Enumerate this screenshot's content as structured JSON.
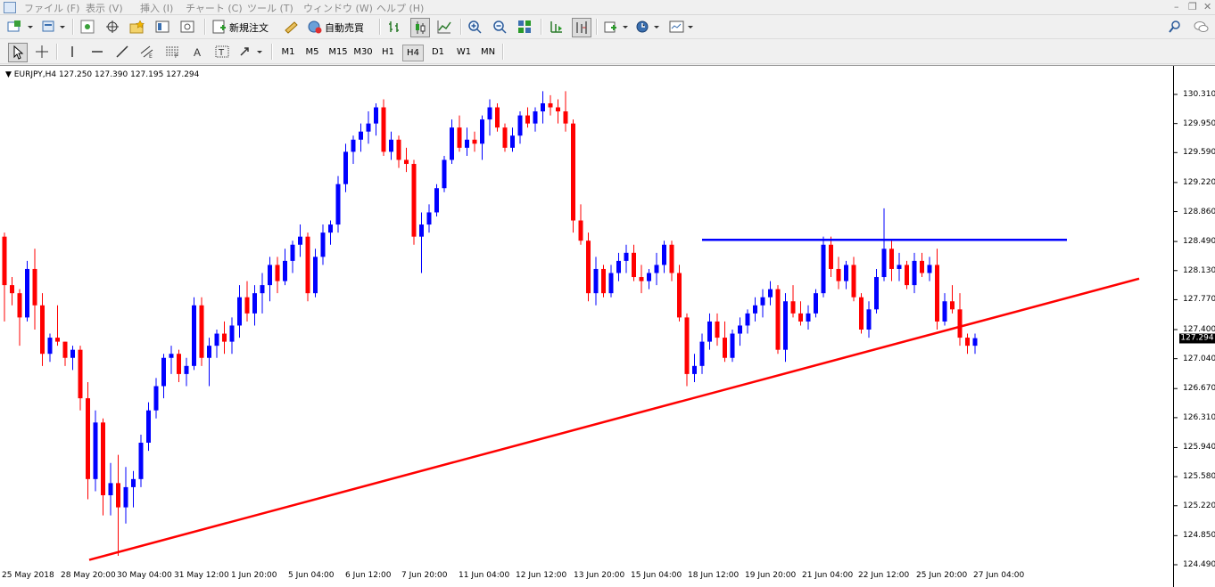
{
  "menu": {
    "items": [
      "ファイル (F)",
      "表示 (V)",
      "挿入 (I)",
      "チャート (C)",
      "ツール (T)",
      "ウィンドウ (W)",
      "ヘルプ (H)"
    ]
  },
  "toolbar": {
    "new_order_label": "新規注文",
    "auto_trade_label": "自動売買"
  },
  "timeframes": [
    "M1",
    "M5",
    "M15",
    "M30",
    "H1",
    "H4",
    "D1",
    "W1",
    "MN"
  ],
  "active_timeframe": "H4",
  "chart_header": {
    "symbol": "EURJPY,H4",
    "ohlc": "127.250 127.390 127.195 127.294"
  },
  "chart_data": {
    "type": "candlestick",
    "symbol": "EURJPY",
    "timeframe": "H4",
    "current_price": "127.294",
    "y_ticks": [
      "130.310",
      "129.950",
      "129.590",
      "129.220",
      "128.860",
      "128.490",
      "128.130",
      "127.770",
      "127.400",
      "127.040",
      "126.670",
      "126.310",
      "125.940",
      "125.580",
      "125.220",
      "124.850",
      "124.490"
    ],
    "x_ticks": [
      "25 May 2018",
      "28 May 20:00",
      "30 May 04:00",
      "31 May 12:00",
      "1 Jun 20:00",
      "5 Jun 04:00",
      "6 Jun 12:00",
      "7 Jun 20:00",
      "11 Jun 04:00",
      "12 Jun 12:00",
      "13 Jun 20:00",
      "15 Jun 04:00",
      "18 Jun 12:00",
      "19 Jun 20:00",
      "21 Jun 04:00",
      "22 Jun 12:00",
      "25 Jun 20:00",
      "27 Jun 04:00"
    ],
    "up_color": "#0000ff",
    "down_color": "#ff0000",
    "candles": [
      [
        128.55,
        128.6,
        127.5,
        127.95
      ],
      [
        127.95,
        128.05,
        127.7,
        127.85
      ],
      [
        127.85,
        127.9,
        127.2,
        127.55
      ],
      [
        127.55,
        128.25,
        127.5,
        128.15
      ],
      [
        128.15,
        128.4,
        127.4,
        127.7
      ],
      [
        127.7,
        127.85,
        126.95,
        127.1
      ],
      [
        127.1,
        127.35,
        127.0,
        127.3
      ],
      [
        127.3,
        127.7,
        127.2,
        127.25
      ],
      [
        127.25,
        127.25,
        126.95,
        127.05
      ],
      [
        127.05,
        127.2,
        126.9,
        127.15
      ],
      [
        127.15,
        127.2,
        126.4,
        126.55
      ],
      [
        126.55,
        126.75,
        125.3,
        125.55
      ],
      [
        125.55,
        126.4,
        125.4,
        126.25
      ],
      [
        126.25,
        126.3,
        125.1,
        125.35
      ],
      [
        125.35,
        125.75,
        125.1,
        125.5
      ],
      [
        125.5,
        125.85,
        124.6,
        125.2
      ],
      [
        125.2,
        125.7,
        125.0,
        125.45
      ],
      [
        125.45,
        125.65,
        125.2,
        125.55
      ],
      [
        125.55,
        126.1,
        125.45,
        126.0
      ],
      [
        126.0,
        126.5,
        125.9,
        126.4
      ],
      [
        126.4,
        126.8,
        126.3,
        126.7
      ],
      [
        126.7,
        127.1,
        126.55,
        127.05
      ],
      [
        127.05,
        127.2,
        126.85,
        127.1
      ],
      [
        127.1,
        127.15,
        126.75,
        126.85
      ],
      [
        126.85,
        127.05,
        126.7,
        126.95
      ],
      [
        126.95,
        127.8,
        126.9,
        127.7
      ],
      [
        127.7,
        127.8,
        126.95,
        127.05
      ],
      [
        127.05,
        127.3,
        126.7,
        127.2
      ],
      [
        127.2,
        127.4,
        127.05,
        127.35
      ],
      [
        127.35,
        127.5,
        127.1,
        127.25
      ],
      [
        127.25,
        127.55,
        127.1,
        127.45
      ],
      [
        127.45,
        127.95,
        127.3,
        127.8
      ],
      [
        127.8,
        128.0,
        127.5,
        127.6
      ],
      [
        127.6,
        127.95,
        127.45,
        127.85
      ],
      [
        127.85,
        128.1,
        127.6,
        127.95
      ],
      [
        127.95,
        128.3,
        127.75,
        128.2
      ],
      [
        128.2,
        128.3,
        127.85,
        128.0
      ],
      [
        128.0,
        128.4,
        127.95,
        128.25
      ],
      [
        128.25,
        128.5,
        128.1,
        128.45
      ],
      [
        128.45,
        128.7,
        128.3,
        128.55
      ],
      [
        128.55,
        128.6,
        127.75,
        127.85
      ],
      [
        127.85,
        128.4,
        127.8,
        128.3
      ],
      [
        128.3,
        128.7,
        128.2,
        128.6
      ],
      [
        128.6,
        128.75,
        128.45,
        128.7
      ],
      [
        128.7,
        129.3,
        128.6,
        129.2
      ],
      [
        129.2,
        129.7,
        129.1,
        129.6
      ],
      [
        129.6,
        129.8,
        129.45,
        129.75
      ],
      [
        129.75,
        129.95,
        129.6,
        129.85
      ],
      [
        129.85,
        130.1,
        129.7,
        129.95
      ],
      [
        129.95,
        130.2,
        129.8,
        130.15
      ],
      [
        130.15,
        130.25,
        129.55,
        129.6
      ],
      [
        129.6,
        129.85,
        129.5,
        129.75
      ],
      [
        129.75,
        129.8,
        129.4,
        129.5
      ],
      [
        129.5,
        129.65,
        129.35,
        129.45
      ],
      [
        129.45,
        129.5,
        128.45,
        128.55
      ],
      [
        128.55,
        128.85,
        128.1,
        128.7
      ],
      [
        128.7,
        128.95,
        128.6,
        128.85
      ],
      [
        128.85,
        129.2,
        128.8,
        129.15
      ],
      [
        129.15,
        129.55,
        129.1,
        129.5
      ],
      [
        129.5,
        130.0,
        129.45,
        129.9
      ],
      [
        129.9,
        130.05,
        129.6,
        129.65
      ],
      [
        129.65,
        129.9,
        129.55,
        129.75
      ],
      [
        129.75,
        129.85,
        129.6,
        129.7
      ],
      [
        129.7,
        130.05,
        129.5,
        130.0
      ],
      [
        130.0,
        130.25,
        129.8,
        130.15
      ],
      [
        130.15,
        130.2,
        129.85,
        129.9
      ],
      [
        129.9,
        129.95,
        129.6,
        129.65
      ],
      [
        129.65,
        129.9,
        129.6,
        129.8
      ],
      [
        129.8,
        130.1,
        129.7,
        130.05
      ],
      [
        130.05,
        130.15,
        129.9,
        129.95
      ],
      [
        129.95,
        130.15,
        129.85,
        130.1
      ],
      [
        130.1,
        130.35,
        129.95,
        130.2
      ],
      [
        130.2,
        130.3,
        130.05,
        130.15
      ],
      [
        130.15,
        130.25,
        129.95,
        130.1
      ],
      [
        130.1,
        130.35,
        129.85,
        129.95
      ],
      [
        129.95,
        130.0,
        128.6,
        128.75
      ],
      [
        128.75,
        128.95,
        128.45,
        128.5
      ],
      [
        128.5,
        128.6,
        127.75,
        127.85
      ],
      [
        127.85,
        128.3,
        127.7,
        128.15
      ],
      [
        128.15,
        128.2,
        127.8,
        127.85
      ],
      [
        127.85,
        128.2,
        127.8,
        128.1
      ],
      [
        128.1,
        128.35,
        128.0,
        128.25
      ],
      [
        128.25,
        128.45,
        128.1,
        128.35
      ],
      [
        128.35,
        128.45,
        128.0,
        128.05
      ],
      [
        128.05,
        128.2,
        127.85,
        128.0
      ],
      [
        128.0,
        128.15,
        127.9,
        128.1
      ],
      [
        128.1,
        128.35,
        127.95,
        128.2
      ],
      [
        128.2,
        128.5,
        128.1,
        128.45
      ],
      [
        128.45,
        128.5,
        128.0,
        128.1
      ],
      [
        128.1,
        128.2,
        127.5,
        127.55
      ],
      [
        127.55,
        127.6,
        126.7,
        126.85
      ],
      [
        126.85,
        127.1,
        126.75,
        126.95
      ],
      [
        126.95,
        127.35,
        126.85,
        127.25
      ],
      [
        127.25,
        127.6,
        127.15,
        127.5
      ],
      [
        127.5,
        127.6,
        127.2,
        127.3
      ],
      [
        127.3,
        127.5,
        127.0,
        127.05
      ],
      [
        127.05,
        127.4,
        127.0,
        127.35
      ],
      [
        127.35,
        127.55,
        127.2,
        127.45
      ],
      [
        127.45,
        127.65,
        127.35,
        127.6
      ],
      [
        127.6,
        127.8,
        127.5,
        127.7
      ],
      [
        127.7,
        127.9,
        127.55,
        127.8
      ],
      [
        127.8,
        128.0,
        127.7,
        127.9
      ],
      [
        127.9,
        127.95,
        127.1,
        127.15
      ],
      [
        127.15,
        127.85,
        127.0,
        127.75
      ],
      [
        127.75,
        127.95,
        127.55,
        127.6
      ],
      [
        127.6,
        127.75,
        127.45,
        127.5
      ],
      [
        127.5,
        127.7,
        127.4,
        127.6
      ],
      [
        127.6,
        127.9,
        127.55,
        127.85
      ],
      [
        127.85,
        128.55,
        127.8,
        128.45
      ],
      [
        128.45,
        128.55,
        128.05,
        128.15
      ],
      [
        128.15,
        128.3,
        127.9,
        128.0
      ],
      [
        128.0,
        128.25,
        127.9,
        128.2
      ],
      [
        128.2,
        128.3,
        127.75,
        127.8
      ],
      [
        127.8,
        127.85,
        127.35,
        127.4
      ],
      [
        127.4,
        127.75,
        127.3,
        127.65
      ],
      [
        127.65,
        128.15,
        127.6,
        128.05
      ],
      [
        128.05,
        128.9,
        128.0,
        128.4
      ],
      [
        128.4,
        128.5,
        128.0,
        128.15
      ],
      [
        128.15,
        128.35,
        128.0,
        128.2
      ],
      [
        128.2,
        128.25,
        127.9,
        127.95
      ],
      [
        127.95,
        128.35,
        127.85,
        128.25
      ],
      [
        128.25,
        128.35,
        128.05,
        128.1
      ],
      [
        128.1,
        128.3,
        128.0,
        128.2
      ],
      [
        128.2,
        128.4,
        127.4,
        127.5
      ],
      [
        127.5,
        127.85,
        127.45,
        127.75
      ],
      [
        127.75,
        127.95,
        127.6,
        127.65
      ],
      [
        127.65,
        127.85,
        127.2,
        127.3
      ],
      [
        127.3,
        127.35,
        127.1,
        127.2
      ],
      [
        127.2,
        127.35,
        127.1,
        127.294
      ]
    ],
    "trendlines": [
      {
        "color": "#0000ff",
        "points": [
          [
            "18 Jun 12:00",
            128.51
          ],
          [
            "26 Jun",
            128.51
          ]
        ]
      },
      {
        "color": "#ff0000",
        "points": [
          [
            "28 May 20:00",
            124.55
          ],
          [
            "27 Jun 20:00",
            128.03
          ]
        ]
      }
    ]
  }
}
